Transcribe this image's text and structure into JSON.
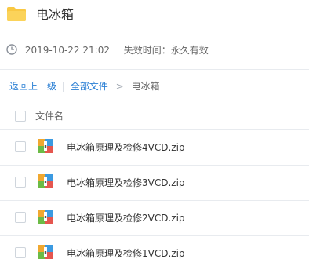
{
  "header": {
    "title": "电冰箱",
    "folder_icon": "folder-icon"
  },
  "meta": {
    "date": "2019-10-22 21:02",
    "expiry": "失效时间：永久有效",
    "clock_icon": "clock-icon"
  },
  "breadcrumb": {
    "back": "返回上一级",
    "separator": "|",
    "all_files": "全部文件",
    "arrow": ">",
    "current": "电冰箱"
  },
  "list": {
    "column_header": "文件名",
    "files": [
      {
        "name": "电冰箱原理及检修4VCD.zip",
        "icon": "zip-archive-icon"
      },
      {
        "name": "电冰箱原理及检修3VCD.zip",
        "icon": "zip-archive-icon"
      },
      {
        "name": "电冰箱原理及检修2VCD.zip",
        "icon": "zip-archive-icon"
      },
      {
        "name": "电冰箱原理及检修1VCD.zip",
        "icon": "zip-archive-icon"
      }
    ]
  },
  "colors": {
    "link": "#2a7fd4",
    "folder": "#f9c843",
    "divider": "#e8ebef"
  }
}
